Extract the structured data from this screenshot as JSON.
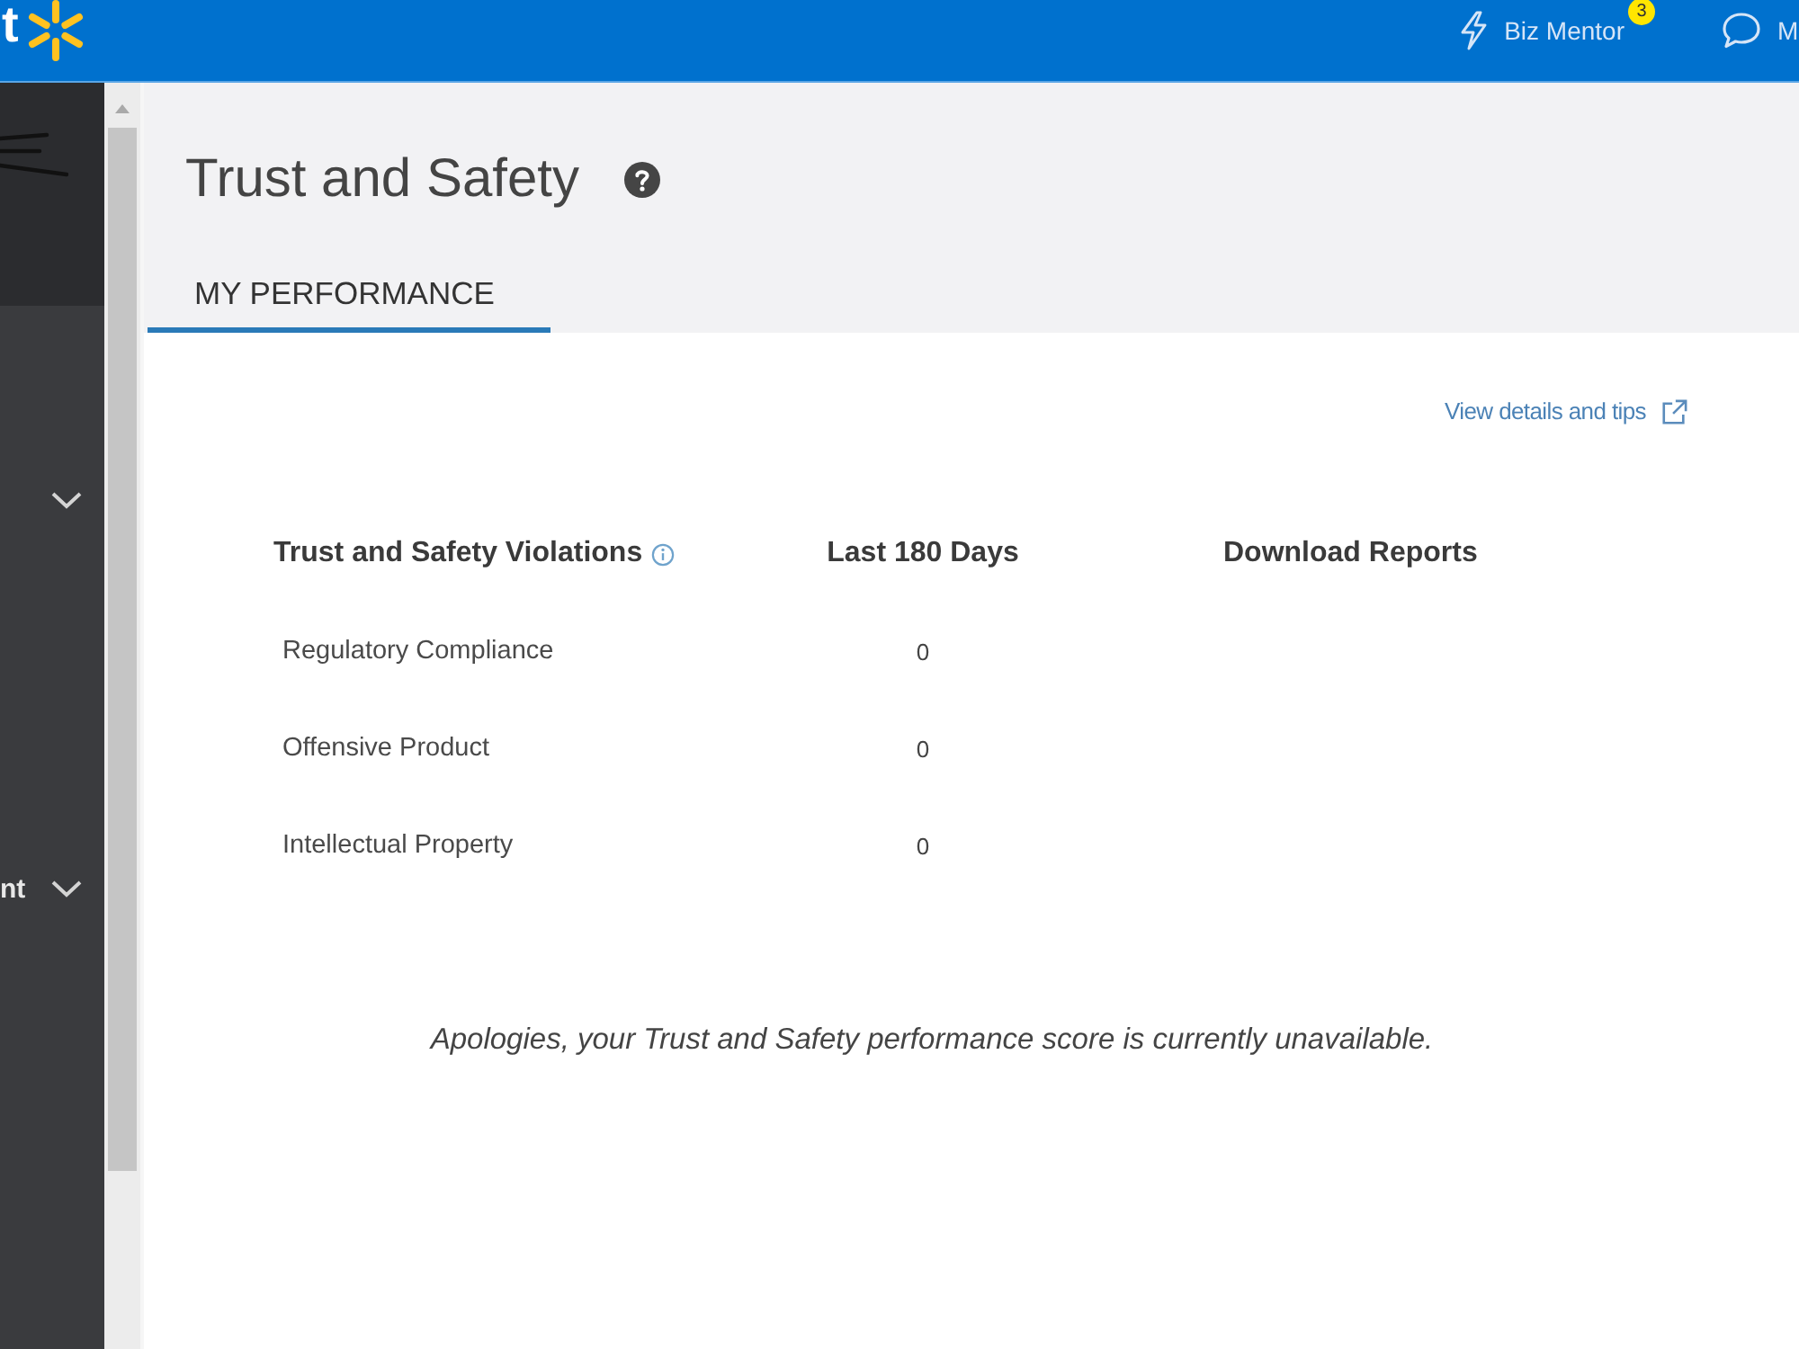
{
  "top_bar": {
    "logo_text": "t",
    "biz_mentor": {
      "label": "Biz Mentor",
      "badge": "3"
    },
    "messages": {
      "label": "M"
    }
  },
  "sidebar": {
    "items": [
      {
        "expanded": false
      },
      {
        "label": "nt",
        "expanded": false
      }
    ]
  },
  "page": {
    "title": "Trust and Safety",
    "tabs": [
      {
        "label": "MY PERFORMANCE",
        "selected": true
      }
    ]
  },
  "details_link": {
    "label": "View details and tips"
  },
  "table": {
    "columns": [
      {
        "label": "Trust and Safety Violations",
        "info": true
      },
      {
        "label": "Last 180 Days",
        "info": false
      },
      {
        "label": "Download Reports",
        "info": false
      }
    ],
    "rows": [
      {
        "violation": "Regulatory Compliance",
        "last_180_days": "0"
      },
      {
        "violation": "Offensive Product",
        "last_180_days": "0"
      },
      {
        "violation": "Intellectual Property",
        "last_180_days": "0"
      }
    ]
  },
  "message": "Apologies, your Trust and Safety performance score is currently unavailable."
}
